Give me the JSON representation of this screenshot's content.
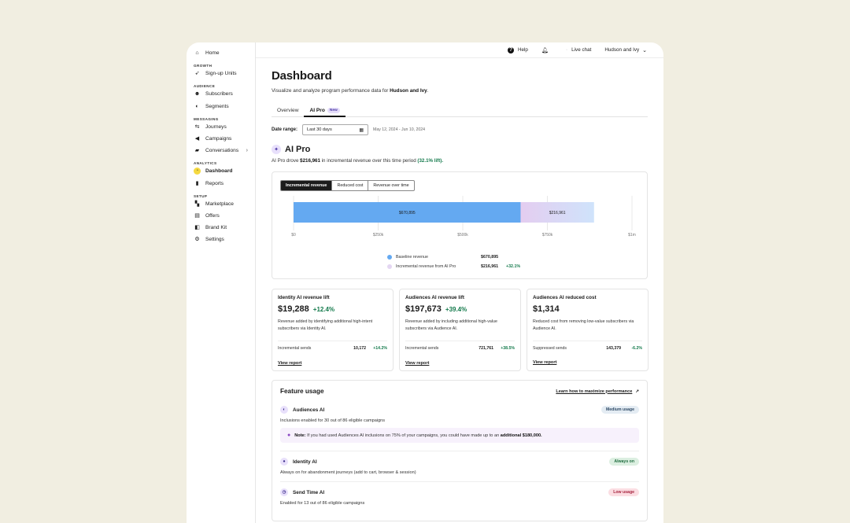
{
  "sidebar": {
    "home": "Home",
    "sections": {
      "growth": "GROWTH",
      "audience": "AUDIENCE",
      "messaging": "MESSAGING",
      "analytics": "ANALYTICS",
      "setup": "SETUP"
    },
    "items": {
      "signup_units": "Sign-up Units",
      "subscribers": "Subscribers",
      "segments": "Segments",
      "journeys": "Journeys",
      "campaigns": "Campaigns",
      "conversations": "Conversations",
      "dashboard": "Dashboard",
      "reports": "Reports",
      "marketplace": "Marketplace",
      "offers": "Offers",
      "brand_kit": "Brand Kit",
      "settings": "Settings"
    }
  },
  "topbar": {
    "help": "Help",
    "live_chat": "Live chat",
    "account": "Hudson and Ivy"
  },
  "page": {
    "title": "Dashboard",
    "subtitle_prefix": "Visualize and analyze program performance data for ",
    "subtitle_brand": "Hudson and Ivy",
    "subtitle_suffix": "."
  },
  "tabs": {
    "overview": "Overview",
    "ai_pro": "AI Pro",
    "new_badge": "New"
  },
  "date": {
    "label": "Date range:",
    "value": "Last 30 days",
    "range": "May 12, 2024 - Jun 10, 2024"
  },
  "ai_pro": {
    "title": "AI Pro",
    "desc_prefix": "AI Pro drove ",
    "desc_amount": "$216,961",
    "desc_mid": " in incremental revenue over this time period ",
    "desc_lift": "(32.1% lift)."
  },
  "chart_toggle": {
    "incremental": "Incremental revenue",
    "reduced": "Reduced cost",
    "over_time": "Revenue over time"
  },
  "chart_data": {
    "type": "bar",
    "orientation": "horizontal-stacked",
    "series": [
      {
        "name": "Baseline revenue",
        "value": 670895,
        "label": "$670,895",
        "color": "#64a9f1"
      },
      {
        "name": "Incremental revenue from AI Pro",
        "value": 216961,
        "label": "$216,961",
        "color_start": "#e4cdf0",
        "color_end": "#cfe3fb"
      }
    ],
    "xlim": [
      0,
      1000000
    ],
    "xticks": [
      "$0",
      "$250k",
      "$500k",
      "$750k",
      "$1m"
    ],
    "legend": [
      {
        "name": "Baseline revenue",
        "value": "$670,895",
        "lift": ""
      },
      {
        "name": "Incremental revenue from AI Pro",
        "value": "$216,961",
        "lift": "+32.1%"
      }
    ],
    "grid": true
  },
  "metrics": [
    {
      "title": "Identity AI revenue lift",
      "value": "$19,288",
      "lift": "+12.4%",
      "desc": "Revenue added by identifying additional high-intent subscribers via Identity AI.",
      "sends_label": "Incremental sends",
      "sends_value": "10,172",
      "sends_pct": "+14.2%",
      "link": "View report"
    },
    {
      "title": "Audiences AI revenue lift",
      "value": "$197,673",
      "lift": "+39.4%",
      "desc": "Revenue added by including additional high-value subscribers via Audience AI.",
      "sends_label": "Incremental sends",
      "sends_value": "721,761",
      "sends_pct": "+38.5%",
      "link": "View report"
    },
    {
      "title": "Audiences AI reduced cost",
      "value": "$1,314",
      "lift": "",
      "desc": "Reduced cost from removing low-value subscribers via Audience AI.",
      "sends_label": "Suppressed sends",
      "sends_value": "143,379",
      "sends_pct": "-6.2%",
      "link": "View report"
    }
  ],
  "feature_usage": {
    "title": "Feature usage",
    "learn_link": "Learn how to maximize performance",
    "features": {
      "audiences": {
        "name": "Audiences AI",
        "badge": "Medium usage",
        "desc": "Inclusions enabled for 30 out of 86 eligible campaigns"
      },
      "identity": {
        "name": "Identity AI",
        "badge": "Always on",
        "desc": "Always on for abandonment journeys (add to cart, browser & session)"
      },
      "send_time": {
        "name": "Send Time AI",
        "badge": "Low usage",
        "desc": "Enabled for 13 out of 86 eligible campaigns"
      }
    },
    "note": {
      "label": "Note:",
      "text": " If you had used Audiences AI inclusions on 75% of your campaigns, you could have made up to an ",
      "amount": "additional $180,000."
    }
  }
}
